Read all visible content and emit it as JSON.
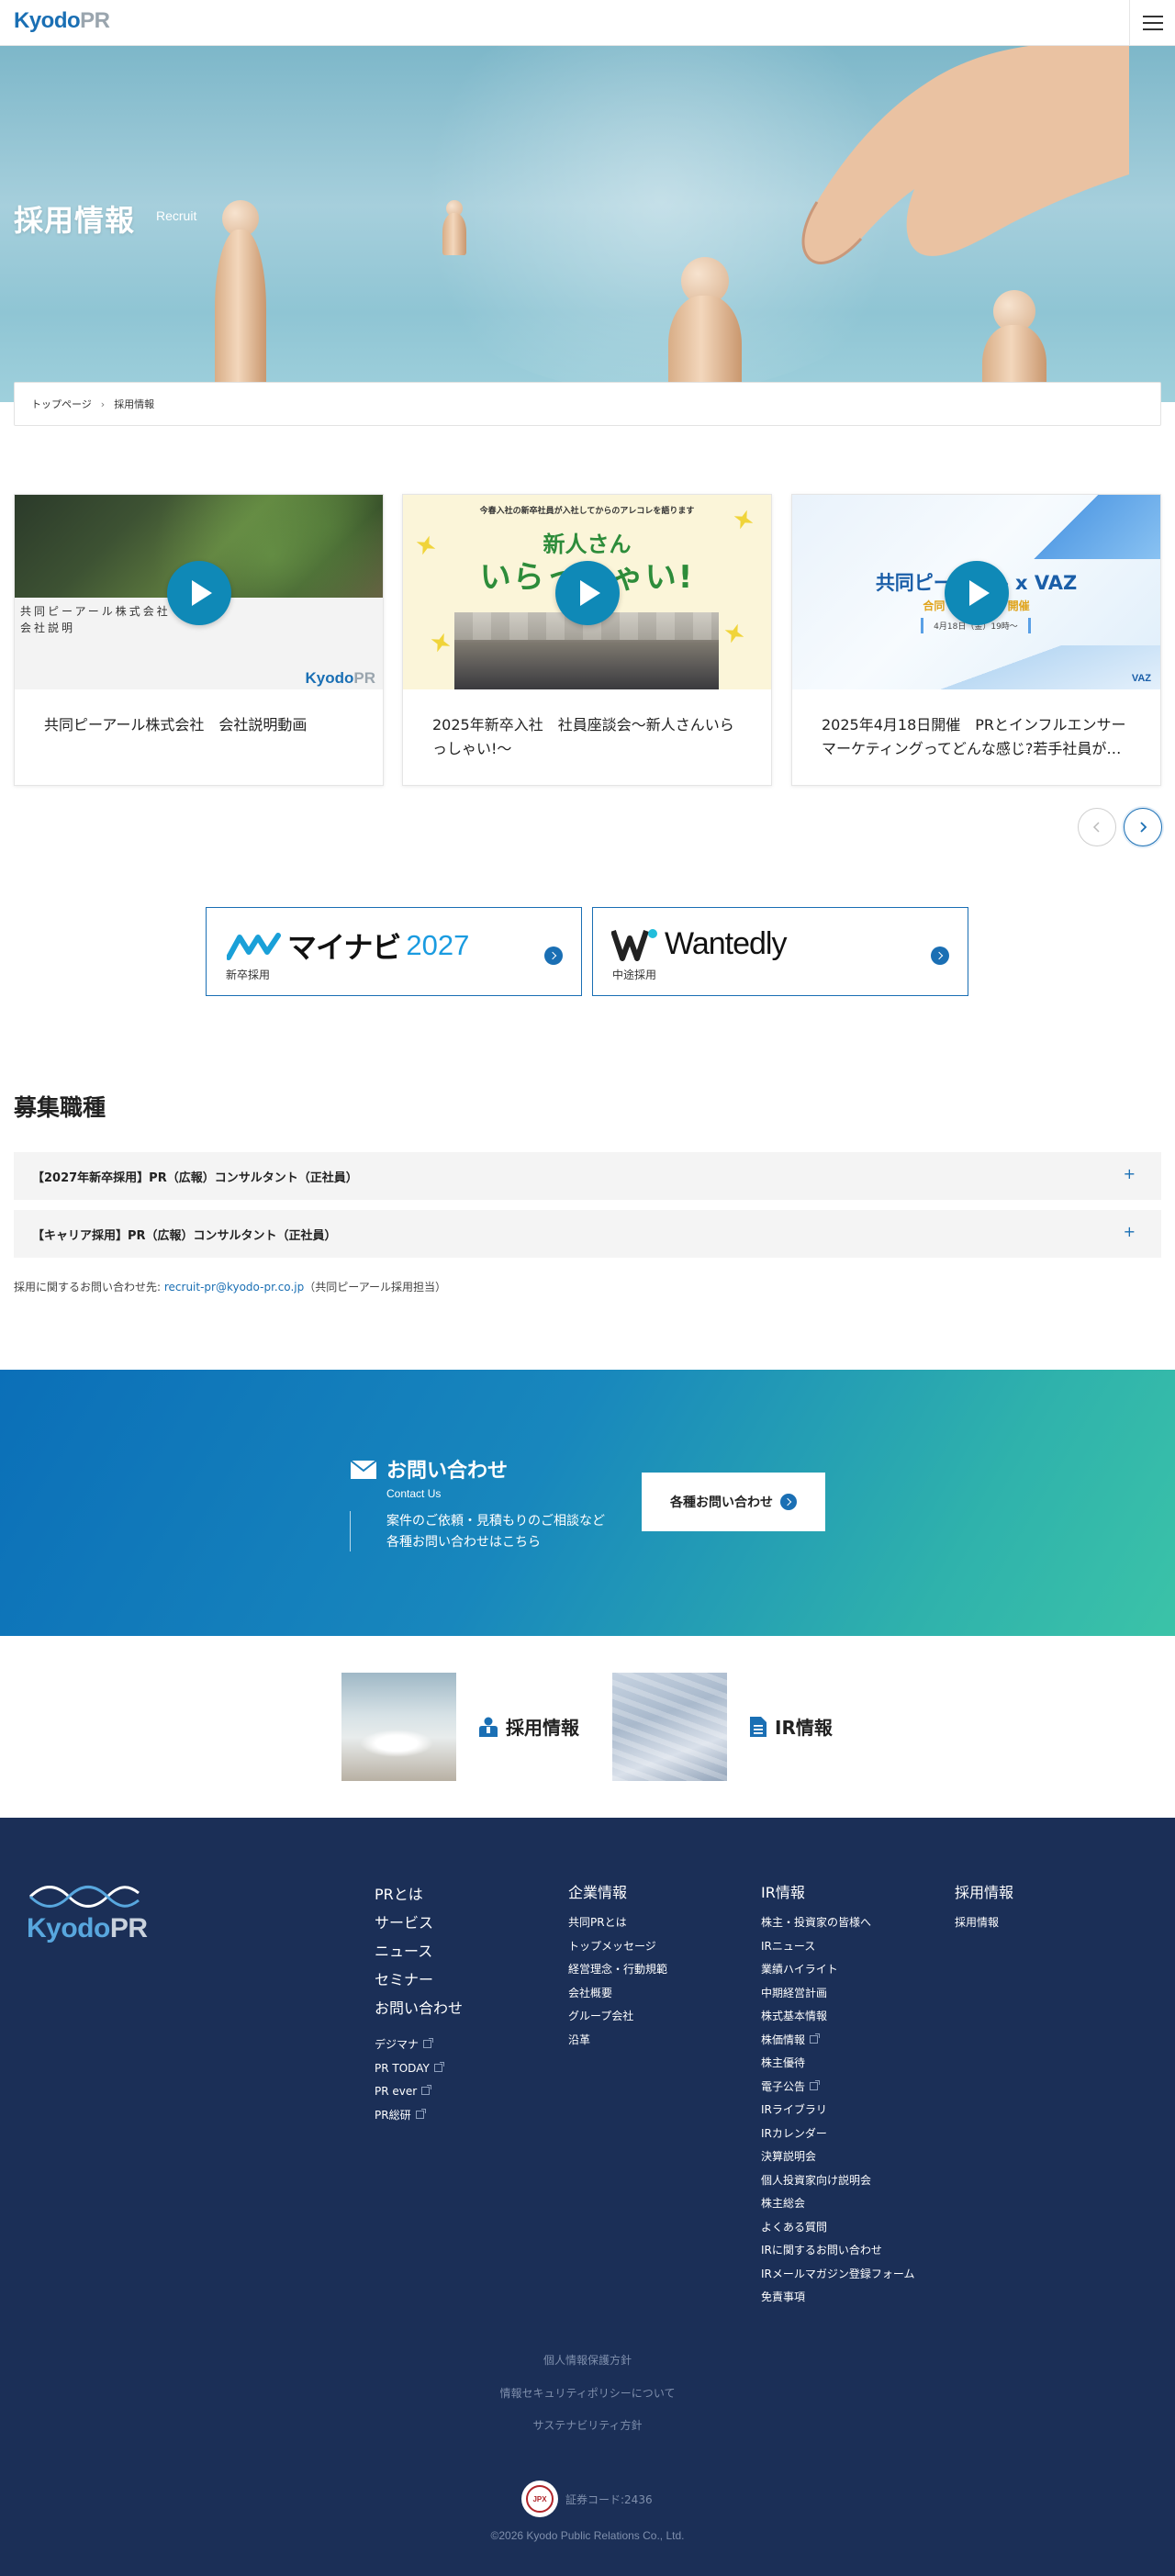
{
  "header": {
    "logo_primary": "Kyodo",
    "logo_secondary": "PR",
    "menu_icon": "hamburger-icon"
  },
  "hero": {
    "title": "採用情報",
    "subtitle": "Recruit"
  },
  "breadcrumb": {
    "home": "トップページ",
    "separator": "›",
    "current": "採用情報"
  },
  "videos": [
    {
      "caption": "共同ピーアール株式会社　会社説明動画",
      "thumb_text": [
        "共同ピーアール株式会社",
        "会社説明"
      ],
      "thumb_logo_primary": "Kyodo",
      "thumb_logo_secondary": "PR"
    },
    {
      "caption": "2025年新卒入社　社員座談会〜新人さんいらっしゃい!〜",
      "thumb_top": "今春入社の新卒社員が入社してからのアレコレを語ります",
      "thumb_line1": "新人さん",
      "thumb_line2": "いらっしゃい!"
    },
    {
      "caption": "2025年4月18日開催　PRとインフルエンサーマーケティングってどんな感じ?若手社員が…",
      "thumb_title": "共同ピーアール x VAZ",
      "thumb_sub": "合同 会社説明会 開催",
      "thumb_date": "4月18日（金）19時〜",
      "thumb_logo": "VAZ"
    }
  ],
  "carousel": {
    "prev_icon": "chevron-left-icon",
    "next_icon": "chevron-right-icon"
  },
  "banners": {
    "mynavi": {
      "logo_jp": "マイナビ",
      "logo_year": "2027",
      "caption": "新卒採用"
    },
    "wantedly": {
      "logo_text": "Wantedly",
      "caption": "中途採用"
    }
  },
  "jobs": {
    "title": "募集職種",
    "items": [
      "【2027年新卒採用】PR（広報）コンサルタント（正社員）",
      "【キャリア採用】PR（広報）コンサルタント（正社員）"
    ],
    "expand_symbol": "+",
    "contact_prefix": "採用に関するお問い合わせ先: ",
    "contact_email": "recruit-pr@kyodo-pr.co.jp",
    "contact_suffix": "（共同ピーアール採用担当）"
  },
  "contact_band": {
    "title": "お問い合わせ",
    "subtitle": "Contact Us",
    "desc1": "案件のご依頼・見積もりのご相談など",
    "desc2": "各種お問い合わせはこちら",
    "button": "各種お問い合わせ",
    "accent": "#0b6fb8"
  },
  "links": {
    "recruit": "採用情報",
    "ir": "IR情報"
  },
  "footer": {
    "logo_primary": "Kyodo",
    "logo_secondary": "PR",
    "col1": {
      "main": [
        "PRとは",
        "サービス",
        "ニュース",
        "セミナー",
        "お問い合わせ"
      ],
      "sub": [
        "デジマナ",
        "PR TODAY",
        "PR ever",
        "PR総研"
      ]
    },
    "col2": {
      "title": "企業情報",
      "items": [
        "共同PRとは",
        "トップメッセージ",
        "経営理念・行動規範",
        "会社概要",
        "グループ会社",
        "沿革"
      ]
    },
    "col3": {
      "title": "IR情報",
      "items": [
        "株主・投資家の皆様へ",
        "IRニュース",
        "業績ハイライト",
        "中期経営計画",
        "株式基本情報",
        "株価情報",
        "株主優待",
        "電子公告",
        "IRライブラリ",
        "IRカレンダー",
        "決算説明会",
        "個人投資家向け説明会",
        "株主総会",
        "よくある質問",
        "IRに関するお問い合わせ",
        "IRメールマガジン登録フォーム",
        "免責事項"
      ]
    },
    "col4": {
      "title": "採用情報",
      "items": [
        "採用情報"
      ]
    },
    "policies": [
      "個人情報保護方針",
      "情報セキュリティポリシーについて",
      "サステナビリティ方針"
    ],
    "jpx_mark": "JPX",
    "stock_code": "証券コード:2436",
    "copyright": "©2026 Kyodo Public Relations Co., Ltd."
  }
}
